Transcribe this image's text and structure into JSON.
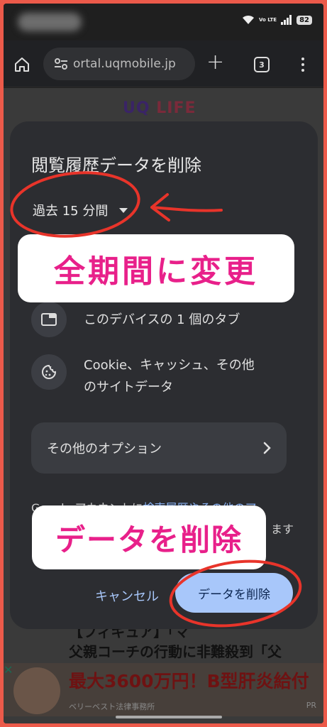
{
  "status_bar": {
    "battery": "82",
    "network": "Vo LTE",
    "signal_icon": "signal-icon",
    "wifi_icon": "wifi-icon"
  },
  "browser": {
    "url": "ortal.uqmobile.jp",
    "tab_count": "3",
    "new_tab_symbol": "+"
  },
  "page": {
    "logo": {
      "part1": "UQ ",
      "part2": "LIFE"
    },
    "headline_line1": "【フィギュア】「マ",
    "headline_line2": "父親コーチの行動に非難殺到「父",
    "ad": {
      "title": "最大3600万円！B型肝炎給付",
      "sponsor": "ベリーベスト法律事務所",
      "pr": "PR"
    }
  },
  "dialog": {
    "title": "閲覧履歴データを削除",
    "period": "過去 15 分間",
    "items": [
      {
        "text": "このデバイスの 1 個のタブ",
        "icon": "tab-icon"
      },
      {
        "text": "Cookie、キャッシュ、その他のサイトデータ",
        "line1": "Cookie、キャッシュ、その他",
        "line2": "のサイトデータ",
        "icon": "cookie-icon"
      }
    ],
    "more_options": "その他のオプション",
    "note_prefix": "Google アカウントに",
    "note_link": "検索履歴やその他のア",
    "note_line2_end": "ます",
    "cancel": "キャンセル",
    "delete": "データを削除"
  },
  "annotations": {
    "callout_change_period": "全期間に変更",
    "callout_delete": "データを削除",
    "annotation_color": "#e8208a",
    "circle_color": "#e8342a"
  }
}
